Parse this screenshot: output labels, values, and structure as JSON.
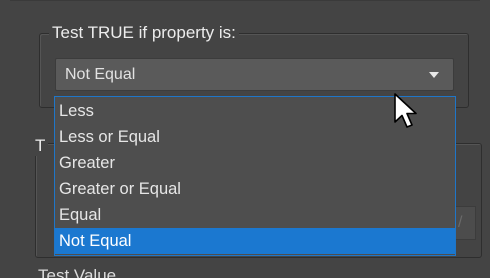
{
  "condition_group": {
    "legend": "Test TRUE if property is:",
    "selected_value": "Not Equal",
    "options": [
      {
        "label": "Less"
      },
      {
        "label": "Less or Equal"
      },
      {
        "label": "Greater"
      },
      {
        "label": "Greater or Equal"
      },
      {
        "label": "Equal"
      },
      {
        "label": "Not Equal",
        "selected": true
      }
    ]
  },
  "second_group": {
    "legend_partial": "T",
    "field_partial": "/"
  },
  "bottom_label_partial": "Test Value",
  "colors": {
    "background": "#444444",
    "combo_background": "#5a5a5a",
    "dropdown_background": "#4e4e4e",
    "selection": "#1b78d0",
    "dropdown_border": "#1f76c8"
  },
  "icons": {
    "combo_arrow": "triangle-down-icon",
    "pointer": "mouse-pointer-icon"
  }
}
